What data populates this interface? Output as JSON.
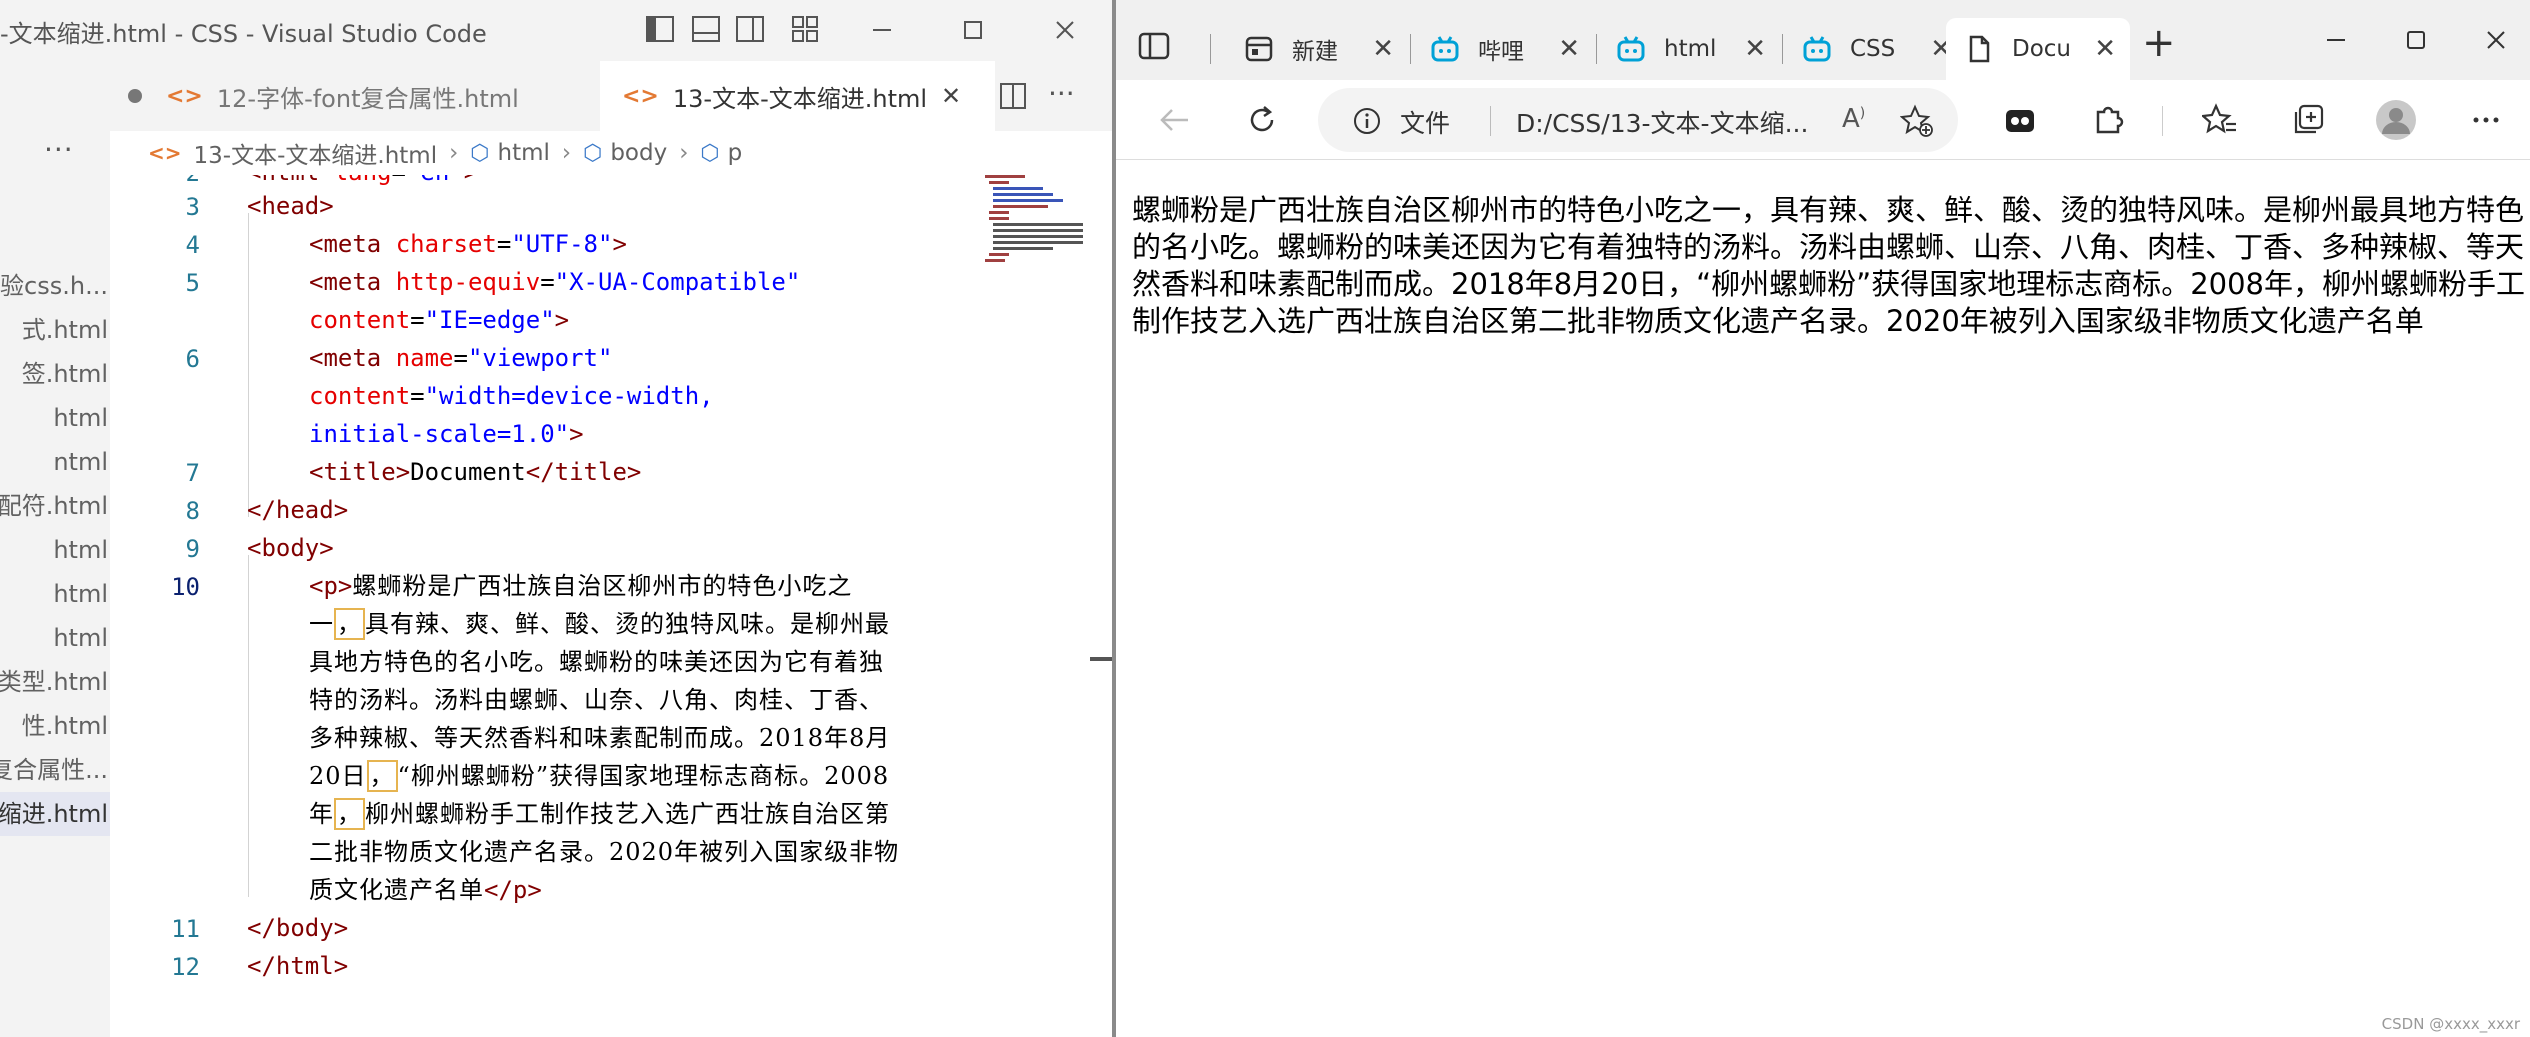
{
  "vscode": {
    "title": "-文本缩进.html - CSS - Visual Studio Code",
    "more_label": "···",
    "tab_more_label": "···",
    "sidebar_files": [
      "实验css.h...",
      "式.html",
      "签.html",
      "html",
      "ntml",
      "配符.html",
      "html",
      "html",
      "html",
      "类型.html",
      "性.html",
      "复合属性...",
      "缩进.html"
    ],
    "active_file_index": 12,
    "tabs": [
      {
        "icon": "<>",
        "label": "12-字体-font复合属性.html",
        "dirty": true
      },
      {
        "icon": "<>",
        "label": "13-文本-文本缩进.html",
        "close": "✕"
      }
    ],
    "breadcrumb": {
      "file": "13-文本-文本缩进.html",
      "items": [
        "html",
        "body",
        "p"
      ]
    },
    "line_numbers": [
      {
        "n": "2"
      },
      {
        "n": "3"
      },
      {
        "n": "4"
      },
      {
        "n": "5"
      },
      {
        "n": "6"
      },
      {
        "n": "7"
      },
      {
        "n": "8"
      },
      {
        "n": "9"
      },
      {
        "n": "10"
      },
      {
        "n": "11"
      },
      {
        "n": "12"
      }
    ],
    "code": {
      "l2": {
        "open": "<html ",
        "attr": "lang",
        "eq": "=",
        "val": "\"en\"",
        "close": ">"
      },
      "l3": "<head>",
      "l4": {
        "open": "<meta ",
        "attr": "charset",
        "eq": "=",
        "val": "\"UTF-8\"",
        "close": ">"
      },
      "l5a": {
        "open": "<meta ",
        "attr": "http-equiv",
        "eq": "=",
        "val": "\"X-UA-Compatible\""
      },
      "l5b": {
        "attr": "content",
        "eq": "=",
        "val": "\"IE=edge\"",
        "close": ">"
      },
      "l6a": {
        "open": "<meta ",
        "attr": "name",
        "eq": "=",
        "val": "\"viewport\""
      },
      "l6b": {
        "attr": "content",
        "eq": "=",
        "val": "\"width=device-width,"
      },
      "l6c": {
        "val": "initial-scale=1.0\"",
        "close": ">"
      },
      "l7": {
        "open": "<title>",
        "text": "Document",
        "close": "</title>"
      },
      "l8": "</head>",
      "l9": "<body>",
      "l10_tag_open": "<p>",
      "l10_lines": [
        "螺蛳粉是广西壮族自治区柳州市的特色小吃之",
        "具有辣、爽、鲜、酸、烫的独特风味。是柳州最",
        "具地方特色的名小吃。螺蛳粉的味美还因为它有着独",
        "特的汤料。汤料由螺蛳、山奈、八角、肉桂、丁香、",
        "多种辣椒、等天然香料和味素配制而成。2018年8月",
        "“柳州螺蛳粉”获得国家地理标志商标。2008",
        "柳州螺蛳粉手工制作技艺入选广西壮族自治区第",
        "二批非物质文化遗产名录。2020年被列入国家级非物",
        "质文化遗产名单"
      ],
      "l10_line2_prefix": "一",
      "l10_line2_hl": "，",
      "l10_line7_prefix": "20日",
      "l10_line7_hl": "，",
      "l10_line8_prefix": "年",
      "l10_line8_hl": "，",
      "l10_tag_close": "</p>",
      "l11": "</body>",
      "l12": "</html>"
    }
  },
  "browser": {
    "tabs": [
      {
        "title": "新建",
        "icon": "newtab-icon"
      },
      {
        "title": "哔哩",
        "icon": "bilibili-icon"
      },
      {
        "title": "html",
        "icon": "bilibili-icon"
      },
      {
        "title": "CSS",
        "icon": "bilibili-icon"
      },
      {
        "title": "Docu",
        "icon": "document-icon"
      }
    ],
    "new_tab_label": "+",
    "address": {
      "scheme_label": "文件",
      "url": "D:/CSS/13-文本-文本缩..."
    },
    "paragraph": "螺蛳粉是广西壮族自治区柳州市的特色小吃之一，具有辣、爽、鲜、酸、烫的独特风味。是柳州最具地方特色的名小吃。螺蛳粉的味美还因为它有着独特的汤料。汤料由螺蛳、山奈、八角、肉桂、丁香、多种辣椒、等天然香料和味素配制而成。2018年8月20日，“柳州螺蛳粉”获得国家地理标志商标。2008年，柳州螺蛳粉手工制作技艺入选广西壮族自治区第二批非物质文化遗产名录。2020年被列入国家级非物质文化遗产名单",
    "watermark": "CSDN @xxxx_xxxr"
  }
}
